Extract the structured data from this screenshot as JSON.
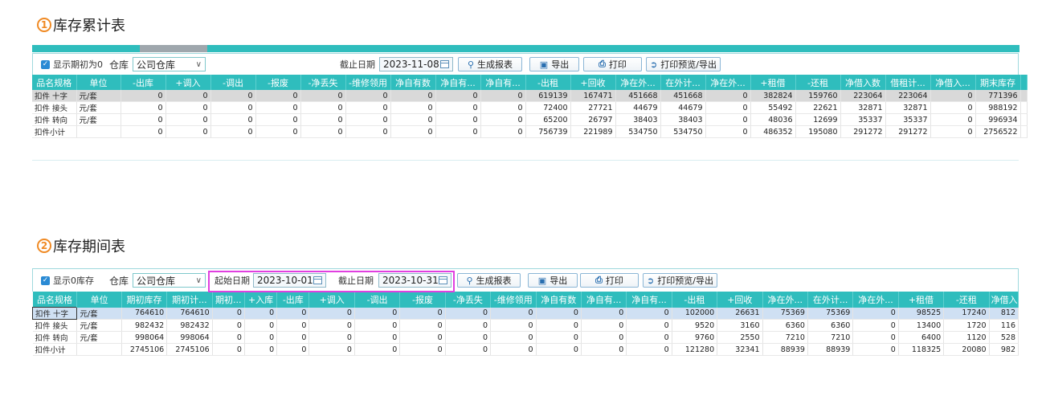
{
  "section1": {
    "number": "1",
    "title": "库存累计表",
    "toolbar": {
      "show_zero_label": "显示期初为0",
      "warehouse_label": "仓库",
      "warehouse_value": "公司仓库",
      "end_date_label": "截止日期",
      "end_date_value": "2023-11-08",
      "generate_label": "生成报表",
      "export_label": "导出",
      "print_label": "打印",
      "preview_label": "打印预览/导出"
    },
    "columns": [
      "品名规格",
      "单位",
      "-出库",
      "+调入",
      "-调出",
      "-报废",
      "-净丢失",
      "-维修领用",
      "净自有数",
      "净自有...",
      "净自有...",
      "-出租",
      "+回收",
      "净在外...",
      "在外计...",
      "净在外...",
      "+租借",
      "-还租",
      "净借入数",
      "借租计...",
      "净借入...",
      "期末库存",
      ""
    ],
    "rows": [
      [
        "扣件 十字",
        "元/套",
        "0",
        "0",
        "0",
        "0",
        "0",
        "0",
        "0",
        "0",
        "0",
        "619139",
        "167471",
        "451668",
        "451668",
        "0",
        "382824",
        "159760",
        "223064",
        "223064",
        "0",
        "771396",
        ""
      ],
      [
        "扣件 接头",
        "元/套",
        "0",
        "0",
        "0",
        "0",
        "0",
        "0",
        "0",
        "0",
        "0",
        "72400",
        "27721",
        "44679",
        "44679",
        "0",
        "55492",
        "22621",
        "32871",
        "32871",
        "0",
        "988192",
        ""
      ],
      [
        "扣件 转向",
        "元/套",
        "0",
        "0",
        "0",
        "0",
        "0",
        "0",
        "0",
        "0",
        "0",
        "65200",
        "26797",
        "38403",
        "38403",
        "0",
        "48036",
        "12699",
        "35337",
        "35337",
        "0",
        "996934",
        ""
      ],
      [
        "扣件小计",
        "",
        "0",
        "0",
        "0",
        "0",
        "0",
        "0",
        "0",
        "0",
        "0",
        "756739",
        "221989",
        "534750",
        "534750",
        "0",
        "486352",
        "195080",
        "291272",
        "291272",
        "0",
        "2756522",
        ""
      ]
    ]
  },
  "section2": {
    "number": "2",
    "title": "库存期间表",
    "toolbar": {
      "show_zero_label": "显示0库存",
      "warehouse_label": "仓库",
      "warehouse_value": "公司仓库",
      "start_date_label": "起始日期",
      "start_date_value": "2023-10-01",
      "end_date_label": "截止日期",
      "end_date_value": "2023-10-31",
      "generate_label": "生成报表",
      "export_label": "导出",
      "print_label": "打印",
      "preview_label": "打印预览/导出"
    },
    "columns": [
      "品名规格",
      "单位",
      "期初库存",
      "期初计...",
      "期初...",
      "+入库",
      "-出库",
      "+调入",
      "-调出",
      "-报废",
      "-净丢失",
      "-维修领用",
      "净自有数",
      "净自有...",
      "净自有...",
      "-出租",
      "+回收",
      "净在外...",
      "在外计...",
      "净在外...",
      "+租借",
      "-还租",
      "净借入数"
    ],
    "rows": [
      [
        "扣件 十字",
        "元/套",
        "764610",
        "764610",
        "0",
        "0",
        "0",
        "0",
        "0",
        "0",
        "0",
        "0",
        "0",
        "0",
        "0",
        "102000",
        "26631",
        "75369",
        "75369",
        "0",
        "98525",
        "17240",
        "812"
      ],
      [
        "扣件 接头",
        "元/套",
        "982432",
        "982432",
        "0",
        "0",
        "0",
        "0",
        "0",
        "0",
        "0",
        "0",
        "0",
        "0",
        "0",
        "9520",
        "3160",
        "6360",
        "6360",
        "0",
        "13400",
        "1720",
        "116"
      ],
      [
        "扣件 转向",
        "元/套",
        "998064",
        "998064",
        "0",
        "0",
        "0",
        "0",
        "0",
        "0",
        "0",
        "0",
        "0",
        "0",
        "0",
        "9760",
        "2550",
        "7210",
        "7210",
        "0",
        "6400",
        "1120",
        "528"
      ],
      [
        "扣件小计",
        "",
        "2745106",
        "2745106",
        "0",
        "0",
        "0",
        "0",
        "0",
        "0",
        "0",
        "0",
        "0",
        "0",
        "0",
        "121280",
        "32341",
        "88939",
        "88939",
        "0",
        "118325",
        "20080",
        "982"
      ]
    ]
  }
}
